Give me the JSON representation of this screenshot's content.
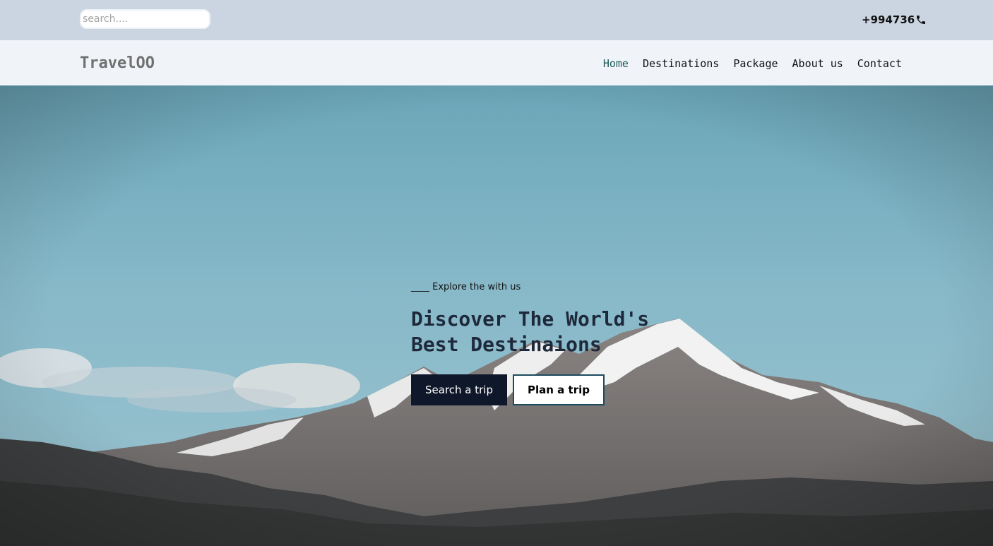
{
  "topbar": {
    "search_placeholder": "search....",
    "phone": "+994736",
    "phone_icon": "phone-icon"
  },
  "navbar": {
    "logo": "TravelOO",
    "links": [
      "Home",
      "Destinations",
      "Package",
      "About us",
      "Contact"
    ],
    "active": "Home"
  },
  "hero": {
    "tagline": "____ Explore the with us",
    "headline_line1": "Discover The World's",
    "headline_line2": "Best Destinaions",
    "primary_button": "Search a trip",
    "secondary_button": "Plan a trip"
  },
  "colors": {
    "topbar_bg": "#cbd5e1",
    "navbar_bg": "#f0f4f9",
    "primary_button_bg": "#0f172a",
    "secondary_button_border": "#1e4b5e",
    "headline": "#1e293b"
  }
}
